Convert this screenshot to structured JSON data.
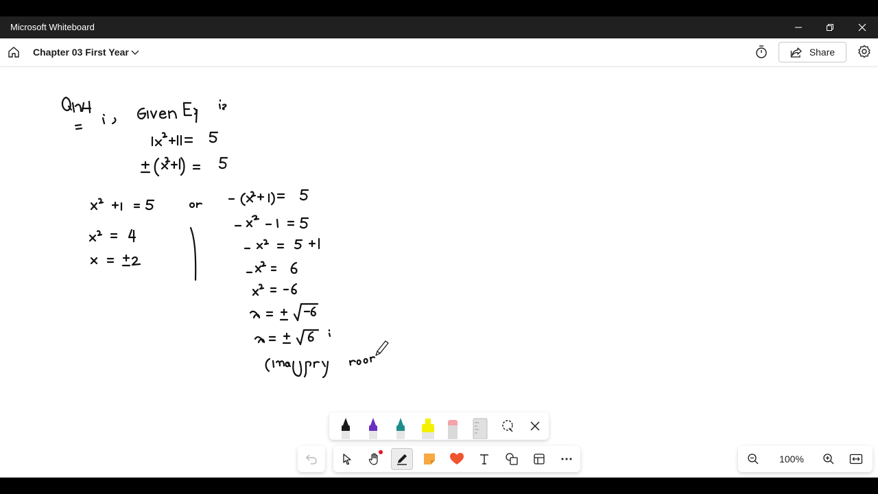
{
  "window": {
    "title": "Microsoft Whiteboard"
  },
  "header": {
    "board_title": "Chapter 03 First Year",
    "share_label": "Share"
  },
  "zoom": {
    "level": "100%"
  },
  "icons": {
    "home": "home-icon",
    "chevron": "chevron-down-icon",
    "timer": "timer-icon",
    "share": "share-icon",
    "settings": "gear-icon",
    "minimize": "minimize-icon",
    "restore": "restore-icon",
    "close": "close-icon"
  },
  "colors": {
    "pen_black": "#1a1a1a",
    "pen_purple": "#6b2fbf",
    "pen_teal": "#1e8c8c",
    "highlighter_yellow": "#f5f000",
    "eraser_pink": "#f4a3a8",
    "sticky": "#f7a944",
    "reaction": "#f0542e",
    "active_dot": "#e81123"
  }
}
